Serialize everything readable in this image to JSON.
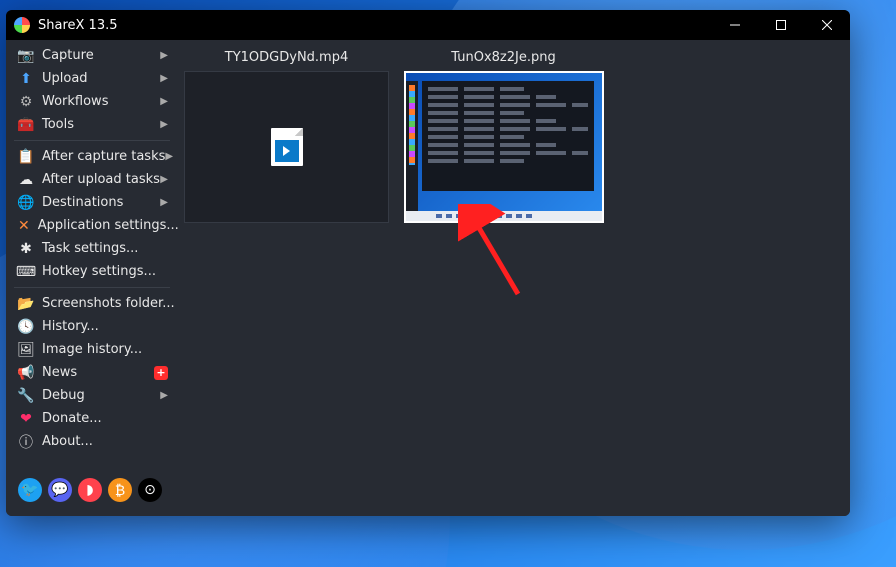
{
  "titlebar": {
    "title": "ShareX 13.5"
  },
  "sidebar": {
    "groups": [
      [
        {
          "icon": "📷",
          "label": "Capture",
          "hasSubmenu": true,
          "color": "#6aa7ff"
        },
        {
          "icon": "⬆",
          "label": "Upload",
          "hasSubmenu": true,
          "color": "#4da6ff"
        },
        {
          "icon": "⚙",
          "label": "Workflows",
          "hasSubmenu": true,
          "color": "#b5b5b5"
        },
        {
          "icon": "🧰",
          "label": "Tools",
          "hasSubmenu": true,
          "color": "#ff4d4d"
        }
      ],
      [
        {
          "icon": "📋",
          "label": "After capture tasks",
          "hasSubmenu": true,
          "color": "#e8e8e8"
        },
        {
          "icon": "☁",
          "label": "After upload tasks",
          "hasSubmenu": true,
          "color": "#e8e8e8"
        },
        {
          "icon": "🌐",
          "label": "Destinations",
          "hasSubmenu": true,
          "color": "#6aa7ff"
        },
        {
          "icon": "✕",
          "label": "Application settings...",
          "hasSubmenu": false,
          "color": "#ff8a3d"
        },
        {
          "icon": "✱",
          "label": "Task settings...",
          "hasSubmenu": false,
          "color": "#e8e8e8"
        },
        {
          "icon": "⌨",
          "label": "Hotkey settings...",
          "hasSubmenu": false,
          "color": "#e8e8e8"
        }
      ],
      [
        {
          "icon": "📂",
          "label": "Screenshots folder...",
          "hasSubmenu": false,
          "color": "#ffd24d"
        },
        {
          "icon": "🕓",
          "label": "History...",
          "hasSubmenu": false,
          "color": "#e8e8e8"
        },
        {
          "icon": "🖼",
          "label": "Image history...",
          "hasSubmenu": false,
          "color": "#e8e8e8"
        },
        {
          "icon": "📢",
          "label": "News",
          "hasSubmenu": false,
          "color": "#ff4d4d",
          "badge": "+"
        },
        {
          "icon": "🔧",
          "label": "Debug",
          "hasSubmenu": true,
          "color": "#ff8a3d"
        },
        {
          "icon": "❤",
          "label": "Donate...",
          "hasSubmenu": false,
          "color": "#ff2d6a"
        },
        {
          "icon": "ⓘ",
          "label": "About...",
          "hasSubmenu": false,
          "color": "#e8e8e8"
        }
      ]
    ],
    "social": [
      {
        "name": "twitter",
        "color": "#1da1f2",
        "glyph": "🐦"
      },
      {
        "name": "discord",
        "color": "#5865f2",
        "glyph": "💬"
      },
      {
        "name": "patreon",
        "color": "#ff424d",
        "glyph": "◗"
      },
      {
        "name": "bitcoin",
        "color": "#f7931a",
        "glyph": "₿"
      },
      {
        "name": "github",
        "color": "#000000",
        "glyph": "⊙"
      }
    ]
  },
  "content": {
    "items": [
      {
        "name": "TY1ODGDyNd.mp4",
        "kind": "video"
      },
      {
        "name": "TunOx8z2Je.png",
        "kind": "screenshot"
      }
    ]
  },
  "colors": {
    "accent_red": "#ff2d2d"
  }
}
